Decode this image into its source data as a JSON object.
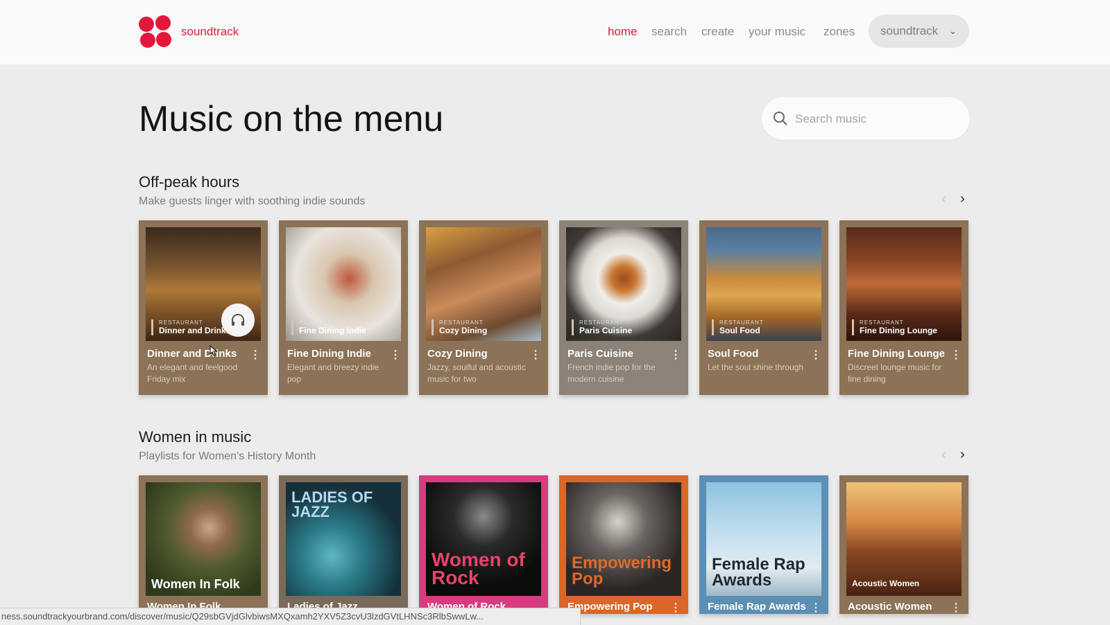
{
  "header": {
    "brand": "soundtrack",
    "nav": [
      "home",
      "search",
      "create",
      "your music",
      "zones"
    ],
    "account": "soundtrack",
    "accent_color": "#e2183b"
  },
  "page": {
    "title": "Music on the menu",
    "search_placeholder": "Search music"
  },
  "sections": [
    {
      "title": "Off-peak hours",
      "subtitle": "Make guests linger with soothing indie sounds",
      "cards": [
        {
          "kicker": "RESTAURANT",
          "overlay": "Dinner and Drinks",
          "name": "Dinner and Drinks",
          "desc": "An elegant and feelgood Friday mix"
        },
        {
          "kicker": "RESTAURANT",
          "overlay": "Fine Dining Indie",
          "name": "Fine Dining Indie",
          "desc": "Elegant and breezy indie pop"
        },
        {
          "kicker": "RESTAURANT",
          "overlay": "Cozy Dining",
          "name": "Cozy Dining",
          "desc": "Jazzy, soulful and acoustic music for two"
        },
        {
          "kicker": "RESTAURANT",
          "overlay": "Paris Cuisine",
          "name": "Paris Cuisine",
          "desc": "French indie pop for the modern cuisine"
        },
        {
          "kicker": "RESTAURANT",
          "overlay": "Soul Food",
          "name": "Soul Food",
          "desc": "Let the soul shine through"
        },
        {
          "kicker": "RESTAURANT",
          "overlay": "Fine Dining Lounge",
          "name": "Fine Dining Lounge",
          "desc": "Discreet lounge music for fine dining"
        }
      ]
    },
    {
      "title": "Women in music",
      "subtitle": "Playlists for Women's History Month",
      "cards": [
        {
          "art": "Women In Folk",
          "name": "Women In Folk"
        },
        {
          "art": "LADIES OF JAZZ",
          "name": "Ladies of Jazz"
        },
        {
          "art": "Women of Rock",
          "name": "Women of Rock"
        },
        {
          "art": "Empowering Pop",
          "name": "Empowering Pop"
        },
        {
          "art": "Female Rap Awards",
          "name": "Female Rap Awards"
        },
        {
          "art": "Acoustic Women",
          "name": "Acoustic Women"
        }
      ]
    }
  ],
  "status_url": "ness.soundtrackyourbrand.com/discover/music/Q29sbGVjdGlvbiwsMXQxamh2YXV5Z3cvU3lzdGVtLHNSc3RlbSwwLw..."
}
